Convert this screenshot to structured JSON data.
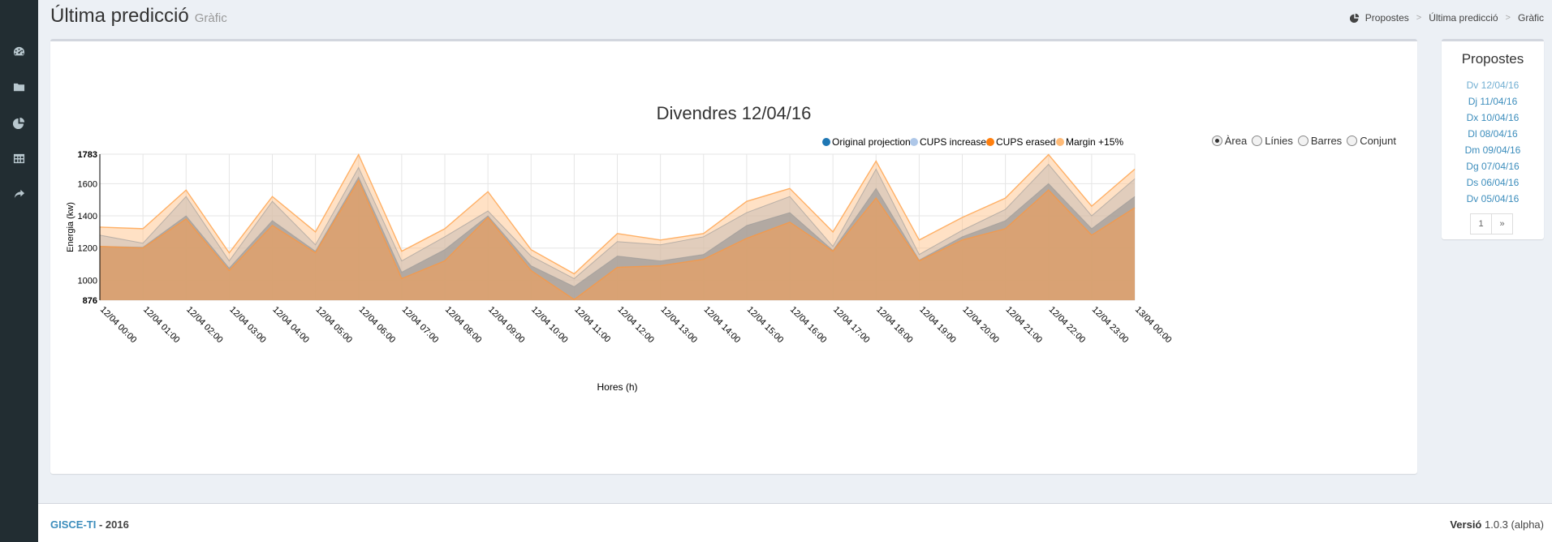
{
  "sidebar": {
    "icons": [
      "dashboard-icon",
      "folder-icon",
      "pie-chart-icon",
      "table-icon",
      "share-icon"
    ]
  },
  "header": {
    "title": "Última predicció",
    "subtitle": "Gràfic",
    "breadcrumb": [
      "Propostes",
      "Última predicció",
      "Gràfic"
    ]
  },
  "chart": {
    "radio_options": [
      "Àrea",
      "Línies",
      "Barres",
      "Conjunt"
    ],
    "selected": "Àrea"
  },
  "chart_data": {
    "type": "area",
    "title": "Divendres 12/04/16",
    "xlabel": "Hores (h)",
    "ylabel": "Energia (kw)",
    "ylim": [
      876,
      1783
    ],
    "yticks": [
      876,
      1000,
      1200,
      1400,
      1600,
      1783
    ],
    "grid": true,
    "legend_placement": "top-right",
    "categories": [
      "12/04 00:00",
      "12/04 01:00",
      "12/04 02:00",
      "12/04 03:00",
      "12/04 04:00",
      "12/04 05:00",
      "12/04 06:00",
      "12/04 07:00",
      "12/04 08:00",
      "12/04 09:00",
      "12/04 10:00",
      "12/04 11:00",
      "12/04 12:00",
      "12/04 13:00",
      "12/04 14:00",
      "12/04 15:00",
      "12/04 16:00",
      "12/04 17:00",
      "12/04 18:00",
      "12/04 19:00",
      "12/04 20:00",
      "12/04 21:00",
      "12/04 22:00",
      "12/04 23:00",
      "13/04 00:00"
    ],
    "series": [
      {
        "name": "Original projection",
        "color": "#1f77b4",
        "values": [
          1210,
          1205,
          1400,
          1075,
          1370,
          1180,
          1640,
          1050,
          1190,
          1400,
          1090,
          960,
          1150,
          1120,
          1160,
          1340,
          1420,
          1185,
          1570,
          1125,
          1270,
          1370,
          1600,
          1320,
          1520
        ]
      },
      {
        "name": "CUPS increased",
        "color": "#aec7e8",
        "values": [
          1280,
          1230,
          1520,
          1120,
          1490,
          1220,
          1700,
          1120,
          1270,
          1430,
          1150,
          1010,
          1240,
          1220,
          1270,
          1420,
          1520,
          1210,
          1690,
          1160,
          1310,
          1440,
          1720,
          1400,
          1630
        ]
      },
      {
        "name": "CUPS erased",
        "color": "#ff7f0e",
        "values": [
          1210,
          1200,
          1380,
          1060,
          1340,
          1170,
          1620,
          1010,
          1120,
          1390,
          1060,
          880,
          1080,
          1090,
          1130,
          1260,
          1360,
          1180,
          1510,
          1120,
          1250,
          1320,
          1560,
          1280,
          1450
        ]
      },
      {
        "name": "Margin +15%",
        "color": "#ffbb78",
        "values": [
          1330,
          1320,
          1560,
          1170,
          1520,
          1300,
          1780,
          1180,
          1320,
          1550,
          1190,
          1040,
          1290,
          1250,
          1290,
          1490,
          1570,
          1300,
          1740,
          1250,
          1390,
          1510,
          1780,
          1460,
          1690
        ]
      }
    ]
  },
  "side": {
    "title": "Propostes",
    "items": [
      "Dv 12/04/16",
      "Dj 11/04/16",
      "Dx 10/04/16",
      "Dl 08/04/16",
      "Dm 09/04/16",
      "Dg 07/04/16",
      "Ds 06/04/16",
      "Dv 05/04/16"
    ],
    "active_index": 0,
    "pagination": [
      "1",
      "»"
    ]
  },
  "footer": {
    "brand": "GISCE-TI",
    "year": "- 2016",
    "version_label": "Versió",
    "version": "1.0.3 (alpha)"
  }
}
